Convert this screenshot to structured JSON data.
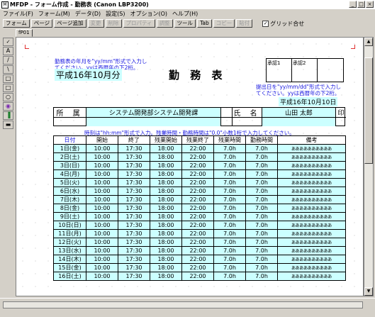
{
  "window": {
    "title": "MFDP - フォーム作成 - 勤務表 (Canon LBP3200)",
    "controls": [
      "_",
      "□",
      "×"
    ]
  },
  "menu": [
    "ファイル(F)",
    "フォーム(M)",
    "データ(D)",
    "設定(S)",
    "オプション(O)",
    "ヘルプ(H)"
  ],
  "toolbar": {
    "buttons": [
      {
        "label": "フォーム",
        "enabled": true
      },
      {
        "label": "ページ",
        "enabled": true
      },
      {
        "label": "ページ追加",
        "enabled": true
      },
      {
        "label": "変更",
        "enabled": false
      },
      {
        "label": "削除",
        "enabled": false
      },
      {
        "label": "プロパティ",
        "enabled": false
      },
      {
        "label": "調整",
        "enabled": false
      },
      {
        "label": "ツール",
        "enabled": true
      },
      {
        "label": "Tab",
        "enabled": true
      },
      {
        "label": "コピー",
        "enabled": false
      },
      {
        "label": "貼付",
        "enabled": false
      }
    ],
    "grid_checkbox": {
      "label": "グリッド合せ",
      "checked": true
    }
  },
  "tab": "fP01",
  "palette": [
    "✓",
    "A",
    "/",
    "\\",
    "□",
    "□",
    "○",
    "◉",
    "▐",
    "▬"
  ],
  "form": {
    "note_month": [
      "勤務表の年月を\"yy/mm\"形式で入力し",
      "てください。yyは西暦年の下2桁。"
    ],
    "month": "平成16年10月分",
    "title": "勤 務 表",
    "stamps": [
      "承認1",
      "承認2",
      ""
    ],
    "note_submit": [
      "提出日を\"yy/mm/dd\"形式で入力し",
      "てください。yyは西暦年の下2桁。"
    ],
    "submit_date": "平成16年10月10日",
    "dept_label": "所 属",
    "dept_value": "システム開発部システム開発課",
    "name_label": "氏 名",
    "name_value": "山田 太郎",
    "seal": "印",
    "note_time": "時刻は\"hh:mm\"形式で入力。残業時間・勤務時間は\"0.0\"小数1桁で入力してください。",
    "columns": [
      "日付",
      "開始",
      "終了",
      "残業開始",
      "残業終了",
      "残業時間",
      "勤務時間",
      "備考"
    ],
    "rows": [
      [
        "1日(金)",
        "10:00",
        "17:30",
        "18:00",
        "22:00",
        "7.0h",
        "7.0h",
        "ああああああああああ"
      ],
      [
        "2日(土)",
        "10:00",
        "17:30",
        "18:00",
        "22:00",
        "7.0h",
        "7.0h",
        "ああああああああああ"
      ],
      [
        "3日(日)",
        "10:00",
        "17:30",
        "18:00",
        "22:00",
        "7.0h",
        "7.0h",
        "ああああああああああ"
      ],
      [
        "4日(月)",
        "10:00",
        "17:30",
        "18:00",
        "22:00",
        "7.0h",
        "7.0h",
        "ああああああああああ"
      ],
      [
        "5日(火)",
        "10:00",
        "17:30",
        "18:00",
        "22:00",
        "7.0h",
        "7.0h",
        "ああああああああああ"
      ],
      [
        "6日(水)",
        "10:00",
        "17:30",
        "18:00",
        "22:00",
        "7.0h",
        "7.0h",
        "ああああああああああ"
      ],
      [
        "7日(木)",
        "10:00",
        "17:30",
        "18:00",
        "22:00",
        "7.0h",
        "7.0h",
        "ああああああああああ"
      ],
      [
        "8日(金)",
        "10:00",
        "17:30",
        "18:00",
        "22:00",
        "7.0h",
        "7.0h",
        "ああああああああああ"
      ],
      [
        "9日(土)",
        "10:00",
        "17:30",
        "18:00",
        "22:00",
        "7.0h",
        "7.0h",
        "ああああああああああ"
      ],
      [
        "10日(日)",
        "10:00",
        "17:30",
        "18:00",
        "22:00",
        "7.0h",
        "7.0h",
        "ああああああああああ"
      ],
      [
        "11日(月)",
        "10:00",
        "17:30",
        "18:00",
        "22:00",
        "7.0h",
        "7.0h",
        "ああああああああああ"
      ],
      [
        "12日(火)",
        "10:00",
        "17:30",
        "18:00",
        "22:00",
        "7.0h",
        "7.0h",
        "ああああああああああ"
      ],
      [
        "13日(水)",
        "10:00",
        "17:30",
        "18:00",
        "22:00",
        "7.0h",
        "7.0h",
        "ああああああああああ"
      ],
      [
        "14日(木)",
        "10:00",
        "17:30",
        "18:00",
        "22:00",
        "7.0h",
        "7.0h",
        "ああああああああああ"
      ],
      [
        "15日(金)",
        "10:00",
        "17:30",
        "18:00",
        "22:00",
        "7.0h",
        "7.0h",
        "ああああああああああ"
      ],
      [
        "16日(土)",
        "10:00",
        "17:30",
        "18:00",
        "22:00",
        "7.0h",
        "7.0h",
        "ああああああああああ"
      ]
    ]
  }
}
